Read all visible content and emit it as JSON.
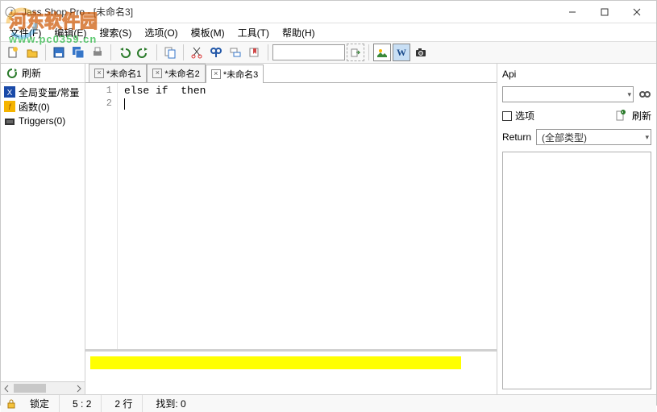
{
  "window": {
    "title": "Jass Shop Pro - [未命名3]"
  },
  "menu": {
    "file": "文件(F)",
    "edit": "编辑(E)",
    "search": "搜索(S)",
    "options": "选项(O)",
    "template": "模板(M)",
    "tools": "工具(T)",
    "help": "帮助(H)"
  },
  "leftpanel": {
    "refresh": "刷新",
    "nodes": {
      "globals": "全局变量/常量",
      "functions": "函数(0)",
      "triggers": "Triggers(0)"
    }
  },
  "tabs": {
    "t1": "*未命名1",
    "t2": "*未命名2",
    "t3": "*未命名3"
  },
  "code": {
    "l1": "else if  then",
    "l2": ""
  },
  "gutter": {
    "n1": "1",
    "n2": "2"
  },
  "api": {
    "title": "Api",
    "opt_label": "选项",
    "refresh": "刷新",
    "return_label": "Return",
    "return_value": "(全部类型)"
  },
  "status": {
    "lock": "锁定",
    "pos": "5 : 2",
    "lines": "2 行",
    "found": "找到: 0"
  },
  "watermark": {
    "cn": "河东软件园",
    "url": "www.pc0359.cn"
  }
}
